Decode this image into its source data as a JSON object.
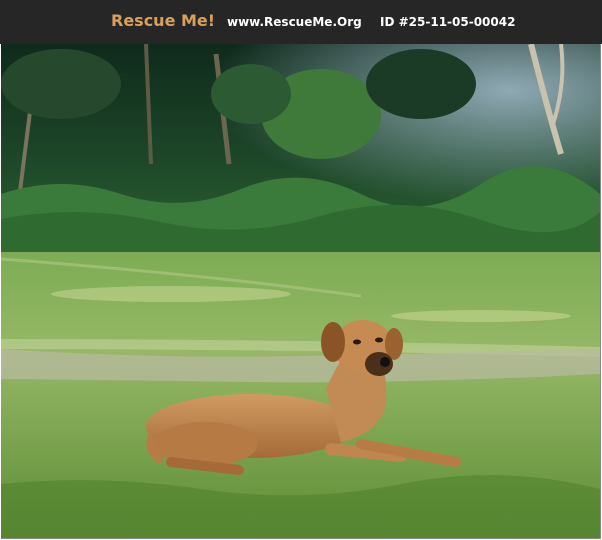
{
  "header": {
    "brand": "Rescue Me!",
    "url": "www.RescueMe.Org",
    "pet_id": "ID #25-11-05-00042"
  },
  "photo": {
    "subject": "dog"
  },
  "colors": {
    "header_bg": "#262626",
    "brand": "#d9a05b",
    "header_text": "#ffffff"
  }
}
